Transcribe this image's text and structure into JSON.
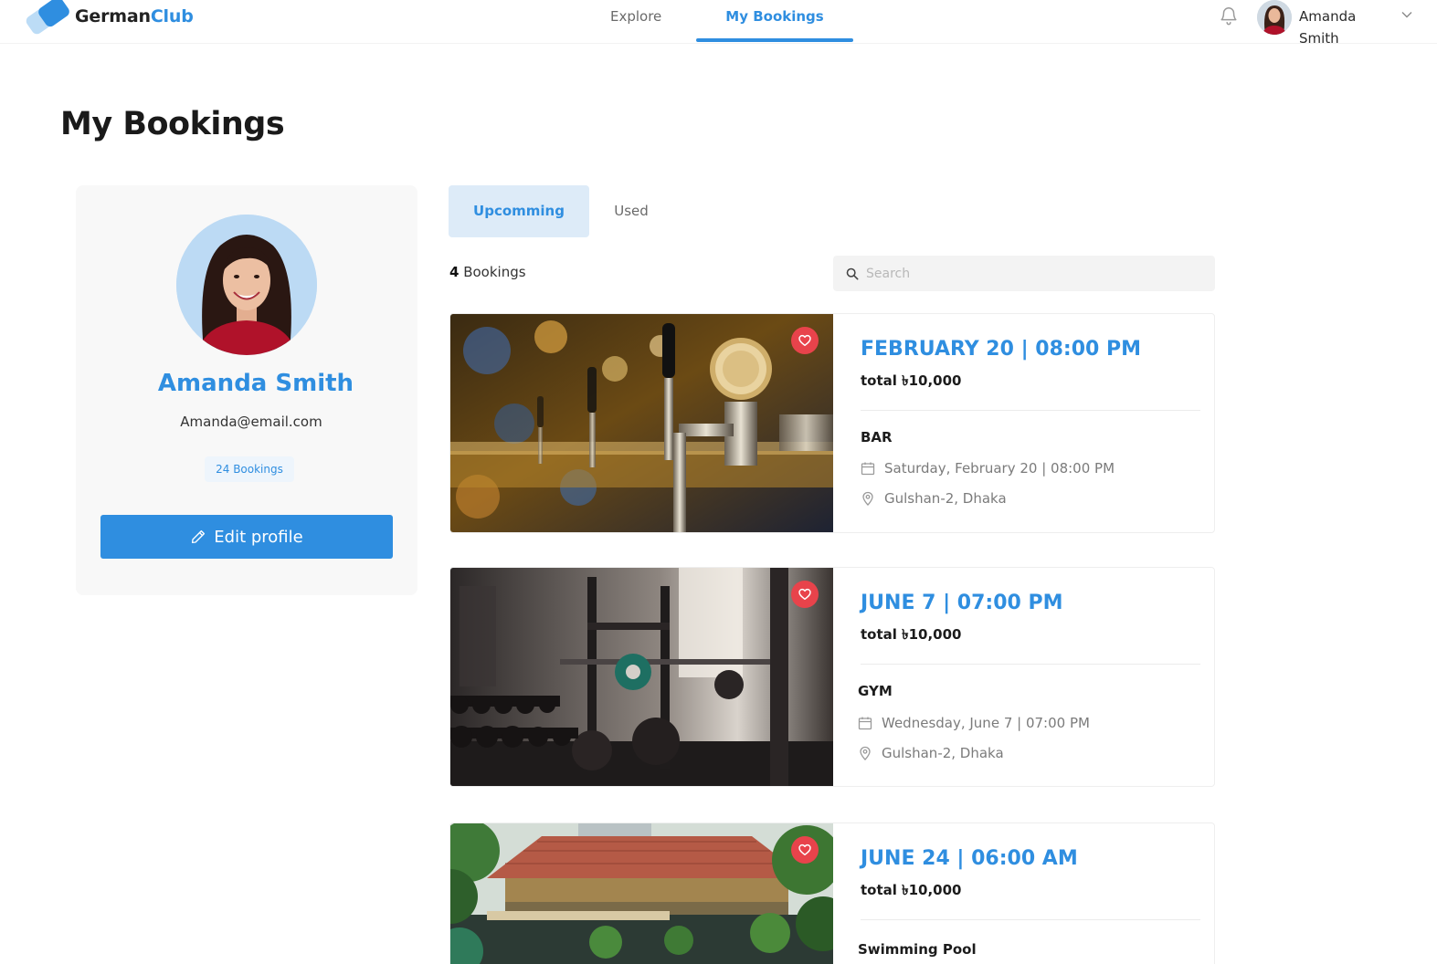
{
  "brand": {
    "name_part1": "German",
    "name_part2": "Club",
    "accent": "#2f8ee0"
  },
  "nav": {
    "explore": "Explore",
    "bookings": "My Bookings",
    "active": "My Bookings"
  },
  "user": {
    "first_name": "Amanda",
    "last_name": "Smith"
  },
  "page": {
    "title": "My Bookings"
  },
  "profile": {
    "name": "Amanda Smith",
    "email": "Amanda@email.com",
    "bookings_badge": "24 Bookings",
    "edit_label": "Edit profile"
  },
  "tabs": {
    "upcoming": "Upcomming",
    "used": "Used",
    "active": "Upcomming"
  },
  "list": {
    "count": "4",
    "count_label": " Bookings"
  },
  "search": {
    "placeholder": "Search",
    "value": ""
  },
  "bookings": [
    {
      "date": "FEBRUARY 20 | 08:00 PM",
      "total": "total ৳10,000",
      "type": "BAR",
      "when": "Saturday, February 20 | 08:00 PM",
      "where": "Gulshan-2, Dhaka",
      "favorited": true
    },
    {
      "date": "JUNE 7 | 07:00 PM",
      "total": "total ৳10,000",
      "type": "GYM",
      "when": "Wednesday, June 7 | 07:00 PM",
      "where": "Gulshan-2, Dhaka",
      "favorited": true
    },
    {
      "date": "JUNE 24 | 06:00 AM",
      "total": "total ৳10,000",
      "type": "Swimming Pool",
      "when": "",
      "where": "",
      "favorited": true
    }
  ],
  "icons": {
    "notification": "bell-icon",
    "favorite": "heart-icon",
    "calendar": "calendar-icon",
    "location": "pin-icon",
    "edit": "pencil-icon",
    "search": "search-icon",
    "dropdown": "chevron-down-icon"
  },
  "colors": {
    "primary": "#2f8ee0",
    "favorite": "#e8434b",
    "tab_active_bg": "#ddebf8"
  }
}
